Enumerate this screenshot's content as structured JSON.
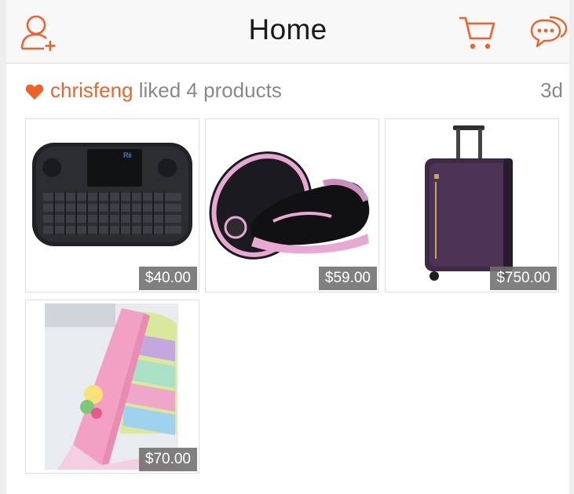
{
  "nav": {
    "title": "Home",
    "left_icon": "add-friend-icon",
    "right_icons": [
      "cart-icon",
      "messages-icon"
    ],
    "accent_color": "#f0612a"
  },
  "feed": {
    "user": "chrisfeng",
    "action": " liked 4 products",
    "time": "3d",
    "icon": "heart-icon",
    "products": [
      {
        "name": "wireless-mini-keyboard",
        "price": "$40.00"
      },
      {
        "name": "pink-black-roller-sneakers",
        "price": "$59.00"
      },
      {
        "name": "purple-carry-on-suitcase",
        "price": "$750.00"
      },
      {
        "name": "pink-kids-bookshelf",
        "price": "$70.00"
      }
    ]
  }
}
